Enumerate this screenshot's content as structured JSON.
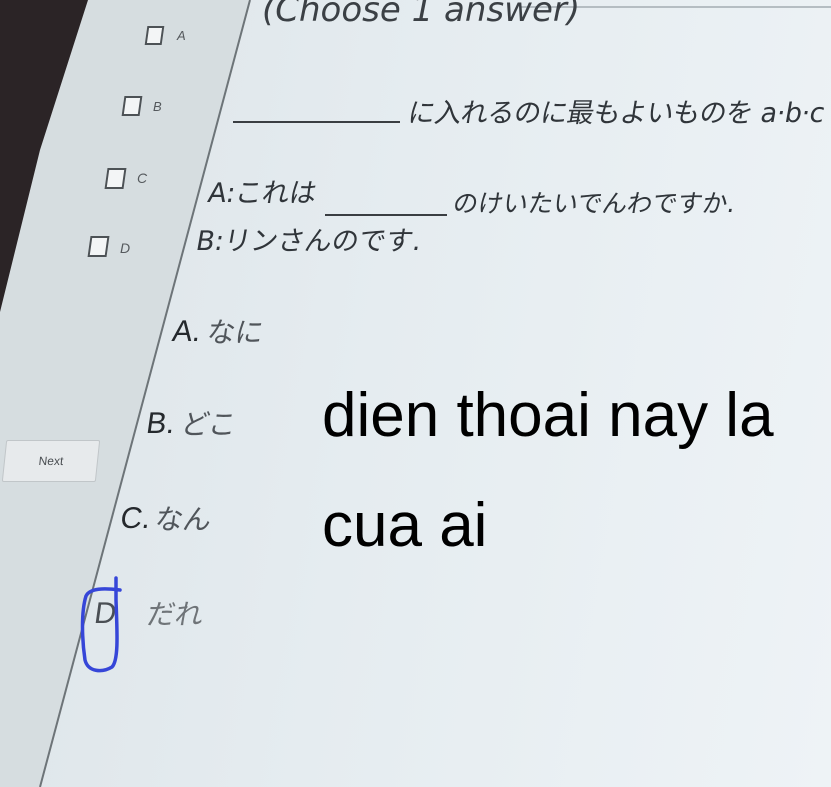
{
  "header": {
    "instruction": "(Choose 1 answer)"
  },
  "sidebar": {
    "checkboxes": [
      {
        "label": "A"
      },
      {
        "label": "B"
      },
      {
        "label": "C"
      },
      {
        "label": "D"
      }
    ],
    "next_label": "Next"
  },
  "question": {
    "prompt": "に入れるのに最もよいものを a·b·c",
    "line_a_start": "A:これは",
    "line_a_end": "のけいたいでんわですか.",
    "line_b": "B:リンさんのです."
  },
  "options": [
    {
      "letter": "A.",
      "text": "なに"
    },
    {
      "letter": "B.",
      "text": "どこ"
    },
    {
      "letter": "C.",
      "text": "なん"
    },
    {
      "letter": "D",
      "text": "だれ"
    }
  ],
  "caption": {
    "line1": "dien thoai nay la",
    "line2": "cua ai"
  },
  "colors": {
    "annotation": "#3646d8",
    "bezel": "#2b2426",
    "sidebar": "#d6dde0",
    "divider": "#6d7478"
  }
}
